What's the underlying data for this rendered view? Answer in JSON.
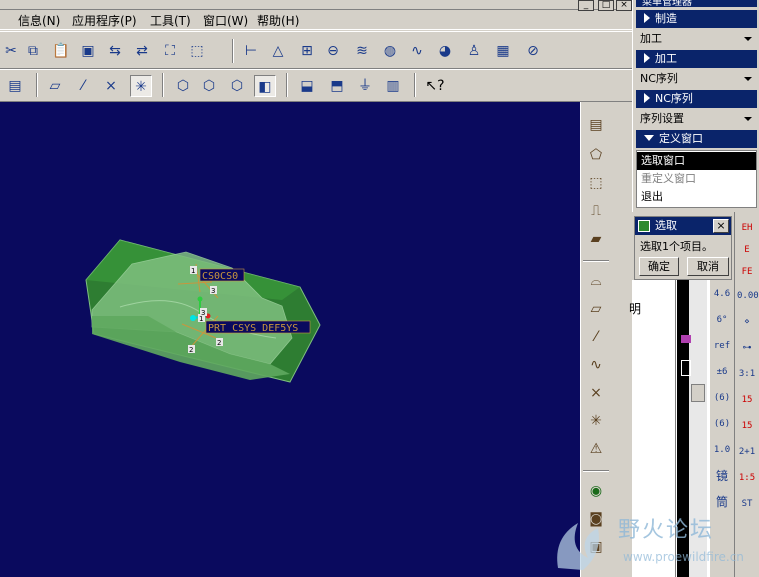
{
  "menubar": {
    "items": [
      "信息(N)",
      "应用程序(P)",
      "工具(T)",
      "窗口(W)",
      "帮助(H)"
    ]
  },
  "menu_manager": {
    "title": "菜单管理器",
    "headers": {
      "manufacture": "制造",
      "machining": "加工",
      "nc_sequence": "NC序列",
      "define_window": "定义窗口"
    },
    "items": {
      "machining": "加工",
      "nc_sequence": "NC序列",
      "sequence_setup": "序列设置"
    },
    "list": [
      "选取窗口",
      "重定义窗口",
      "退出"
    ]
  },
  "select_dialog": {
    "title": "选取",
    "message": "选取1个项目。",
    "ok_label": "确定",
    "cancel_label": "取消"
  },
  "viewport": {
    "csys_labels": [
      "CS0CS0",
      "PRT_CSYS_DEF5YS"
    ],
    "axis_tags": [
      "1",
      "3",
      "2",
      "1",
      "2",
      "3"
    ],
    "background_color": "#0a0a5e",
    "model_color": "#2e7d32"
  },
  "background_window": {
    "text": "明"
  },
  "right_toolbar_labels": [
    "EH",
    "E",
    "FE",
    "0.00",
    "4.6",
    "6°",
    "ref",
    "±6",
    "(6)",
    "(6)",
    "1.0",
    "3:1",
    "15",
    "15",
    "2+1",
    "1:5",
    "ST",
    "镜",
    "筒"
  ],
  "watermark": {
    "title": "野火论坛",
    "url": "www.proewildfire.cn"
  },
  "icons": {
    "menu_window_close": "close-icon",
    "menu_window_minimize": "minimize-icon"
  }
}
